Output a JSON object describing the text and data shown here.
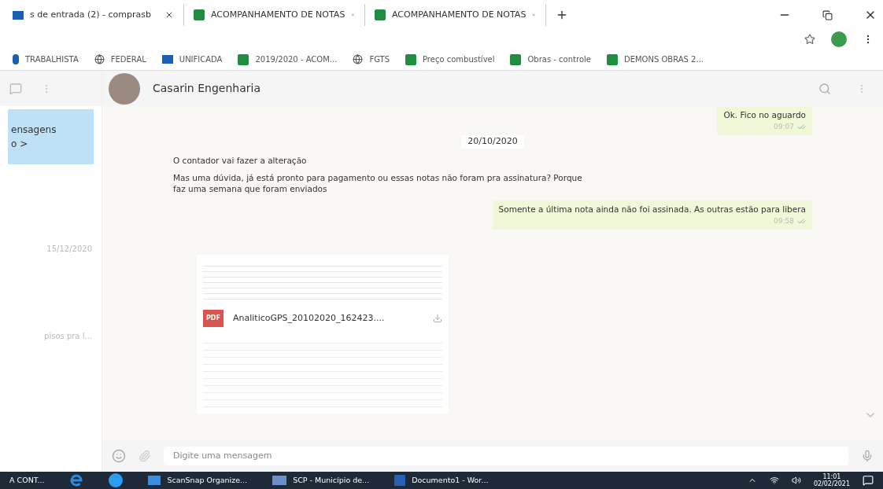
{
  "browser_tabs": [
    {
      "title": "s de entrada (2) - comprasb",
      "kind": "mail"
    },
    {
      "title": "ACOMPANHAMENTO DE NOTAS",
      "kind": "sheet"
    },
    {
      "title": "ACOMPANHAMENTO DE NOTAS",
      "kind": "sheet"
    }
  ],
  "bookmarks": [
    {
      "label": "TRABALHISTA",
      "kind": "logo"
    },
    {
      "label": "FEDERAL",
      "kind": "globe"
    },
    {
      "label": "UNIFICADA",
      "kind": "mail"
    },
    {
      "label": "2019/2020 - ACOM...",
      "kind": "sheet"
    },
    {
      "label": "FGTS",
      "kind": "globe"
    },
    {
      "label": "Preço combustível",
      "kind": "sheet"
    },
    {
      "label": "Obras - controle",
      "kind": "sheet"
    },
    {
      "label": "DEMONS OBRAS 2...",
      "kind": "sheet"
    }
  ],
  "chat_header": {
    "name": "Casarin Engenharia"
  },
  "sidebar": {
    "banner": [
      "ensagens",
      "o >"
    ],
    "items": [
      {
        "text": "15/12/2020"
      },
      {
        "text": "pisos pra l..."
      }
    ]
  },
  "messages": [
    {
      "kind": "outgoing",
      "text": "Ok. Fico no aguardo",
      "time": "09:07",
      "read": true
    },
    {
      "kind": "date",
      "text": "20/10/2020"
    },
    {
      "kind": "incoming",
      "text": "O contador vai fazer a alteração"
    },
    {
      "kind": "incoming",
      "text": "Mas uma dúvida, já está pronto para pagamento ou essas notas não foram pra assinatura? Porque faz uma semana que foram enviados"
    },
    {
      "kind": "outgoing",
      "text": "Somente a última nota ainda não foi assinada. As outras estão para libera",
      "time": "09:58",
      "read": true
    },
    {
      "kind": "document",
      "text": "AnaliticoGPS_20102020_162423....",
      "badge": "PDF"
    }
  ],
  "composer": {
    "placeholder": "Digite uma mensagem"
  },
  "taskbar": {
    "items": [
      {
        "label": "A CONT...",
        "kind": "none"
      },
      {
        "kind": "ie"
      },
      {
        "kind": "edge"
      },
      {
        "label": "ScanSnap Organize...",
        "kind": "folder"
      },
      {
        "label": "SCP - Município de...",
        "kind": "scp"
      },
      {
        "label": "Documento1 - Wor...",
        "kind": "word"
      }
    ],
    "time": "11:01",
    "date": "02/02/2021"
  }
}
